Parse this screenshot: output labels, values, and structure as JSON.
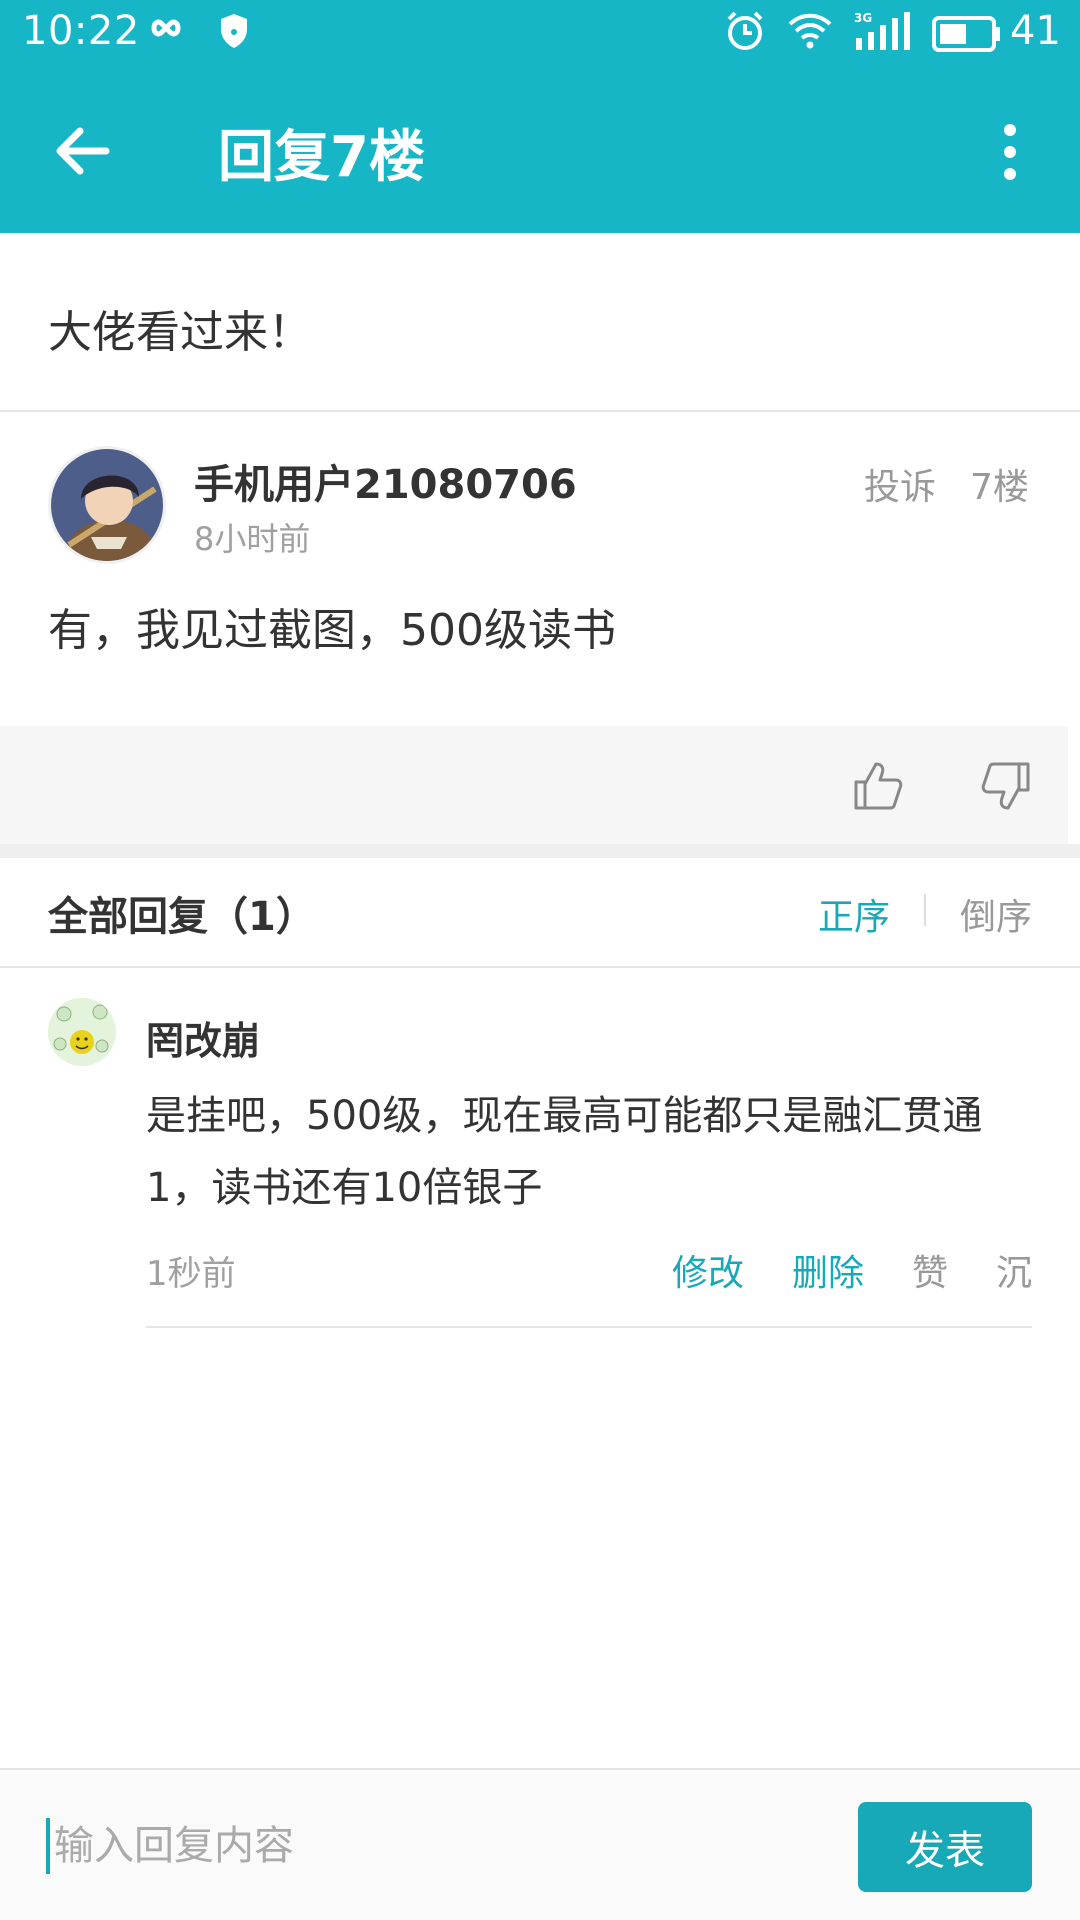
{
  "status_bar": {
    "time": "10:22",
    "battery_level": "41",
    "icons": [
      "infinity-icon",
      "shield-icon",
      "alarm-icon",
      "wifi-icon",
      "signal-3g-icon",
      "battery-icon"
    ]
  },
  "app_bar": {
    "title": "回复7楼",
    "back_icon": "arrow-left-icon",
    "more_icon": "more-vertical-icon",
    "color": "#17b6c6"
  },
  "post": {
    "title": "大佬看过来！"
  },
  "floor_post": {
    "username": "手机用户21080706",
    "time": "8小时前",
    "report_label": "投诉",
    "floor_label": "7楼",
    "content": "有，我见过截图，500级读书"
  },
  "replies": {
    "header": "全部回复（1）",
    "sort_asc": "正序",
    "sort_desc": "倒序",
    "items": [
      {
        "username": "罔改崩",
        "content": "是挂吧，500级，现在最高可能都只是融汇贯通1，读书还有10倍银子",
        "time": "1秒前",
        "edit_label": "修改",
        "delete_label": "删除",
        "like_label": "赞",
        "sink_label": "沉"
      }
    ]
  },
  "bottom_bar": {
    "input_placeholder": "输入回复内容",
    "input_value": "",
    "send_label": "发表"
  },
  "colors": {
    "accent": "#17a9b8",
    "header": "#17b6c6"
  }
}
